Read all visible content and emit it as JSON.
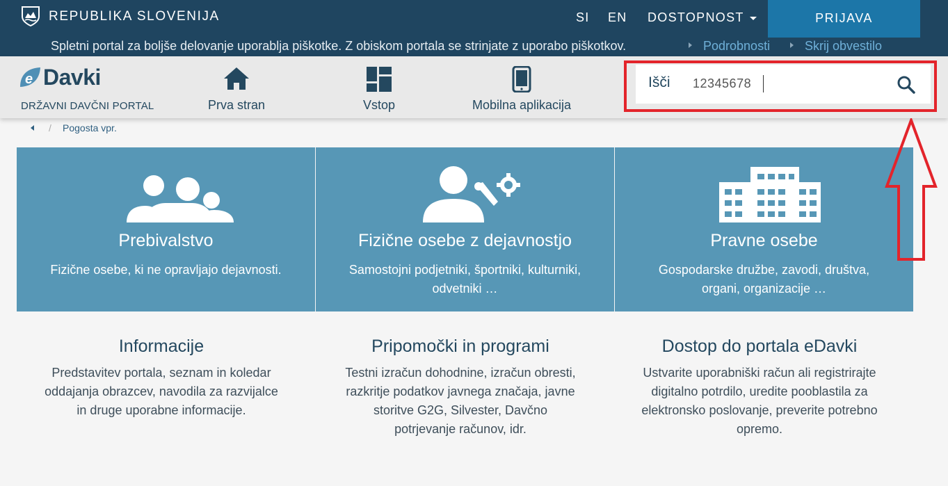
{
  "header": {
    "country": "REPUBLIKA SLOVENIJA",
    "lang_si": "SI",
    "lang_en": "EN",
    "accessibility": "DOSTOPNOST",
    "login": "PRIJAVA"
  },
  "cookie_notice": {
    "text": "Spletni portal za boljše delovanje uporablja piškotke. Z obiskom portala se strinjate z uporabo piškotkov.",
    "details_link": "Podrobnosti",
    "hide_link": "Skrij obvestilo"
  },
  "nav": {
    "logo_text": "Davki",
    "logo_sub": "DRŽAVNI DAVČNI PORTAL",
    "home": "Prva stran",
    "login": "Vstop",
    "mobile": "Mobilna aplikacija"
  },
  "search": {
    "label": "Išči",
    "value": "12345678"
  },
  "breadcrumb": {
    "current": "Pogosta vpr."
  },
  "tiles": [
    {
      "title": "Prebivalstvo",
      "desc": "Fizične osebe, ki ne opravljajo dejavnosti."
    },
    {
      "title": "Fizične osebe z dejavnostjo",
      "desc": "Samostojni podjetniki, športniki, kulturniki, odvetniki …"
    },
    {
      "title": "Pravne osebe",
      "desc": "Gospodarske družbe, zavodi, društva, organi, organizacije …"
    }
  ],
  "info": [
    {
      "title": "Informacije",
      "desc": "Predstavitev portala, seznam in koledar oddajanja obrazcev, navodila za razvijalce in druge uporabne informacije."
    },
    {
      "title": "Pripomočki in programi",
      "desc": "Testni izračun dohodnine, izračun obresti, razkritje podatkov javnega značaja, javne storitve G2G, Silvester, Davčno potrjevanje računov, idr."
    },
    {
      "title": "Dostop do portala eDavki",
      "desc": "Ustvarite uporabniški račun ali registrirajte digitalno potrdilo, uredite pooblastila za elektronsko poslovanje, preverite potrebno opremo."
    }
  ],
  "colors": {
    "header_bg": "#1f4560",
    "login_bg": "#1c76a8",
    "tile_bg": "#5797b6",
    "highlight": "#e3242b"
  }
}
